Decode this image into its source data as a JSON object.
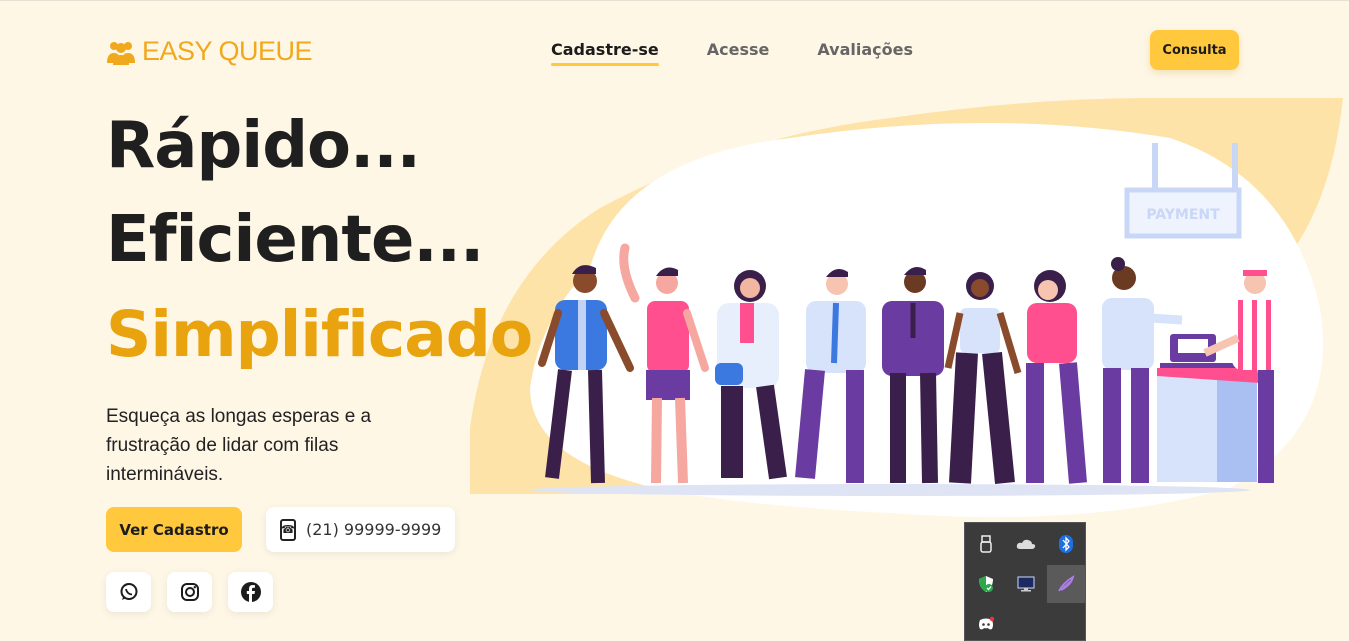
{
  "header": {
    "logo_text": "EASY QUEUE",
    "nav": [
      {
        "label": "Cadastre-se",
        "active": true
      },
      {
        "label": "Acesse",
        "active": false
      },
      {
        "label": "Avaliações",
        "active": false
      }
    ],
    "consulta_label": "Consulta"
  },
  "hero": {
    "line1": "Rápido...",
    "line2": "Eficiente...",
    "line3": "Simplificado",
    "description": "Esqueça as longas esperas e a frustração de lidar com filas intermináveis.",
    "cta_label": "Ver Cadastro",
    "phone": "(21) 99999-9999"
  },
  "illustration": {
    "sign_text": "PAYMENT"
  },
  "social": [
    {
      "icon": "whatsapp-icon"
    },
    {
      "icon": "instagram-icon"
    },
    {
      "icon": "facebook-icon"
    }
  ],
  "tray": {
    "icons": [
      "usb-icon",
      "onedrive-icon",
      "bluetooth-icon",
      "security-icon",
      "display-icon",
      "feather-icon",
      "discord-icon"
    ]
  },
  "colors": {
    "accent": "#ffc83d",
    "headline_accent": "#e8a30e",
    "background": "#fff7e6",
    "blob": "#fde3a7"
  }
}
